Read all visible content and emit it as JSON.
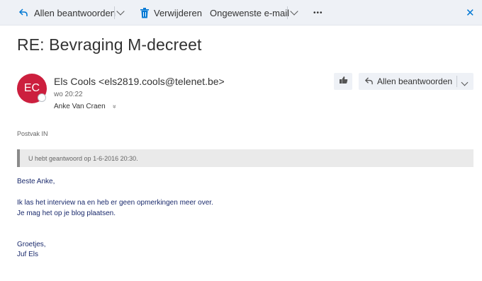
{
  "toolbar": {
    "reply_all_label": "Allen beantwoorden",
    "delete_label": "Verwijderen",
    "junk_label": "Ongewenste e-mail",
    "more_label": "•••",
    "close_label": "✕",
    "accent": "#0078d4"
  },
  "message": {
    "subject": "RE: Bevraging M-decreet",
    "sender_initials": "EC",
    "sender": "Els Cools <els2819.cools@telenet.be>",
    "sent": "wo 20:22",
    "to": "Anke Van Craen",
    "expand_icon": "»",
    "reply_all_label": "Allen beantwoorden",
    "folder": "Postvak IN",
    "notice": "U hebt geantwoord op 1-6-2016 20:30.",
    "avatar_color": "#cc1f3e"
  },
  "body": {
    "greeting": "Beste Anke,",
    "line1": "Ik las het interview na en heb er geen opmerkingen meer over.",
    "line2": "Je mag het op je blog plaatsen.",
    "closing": "Groetjes,",
    "signature": "Juf Els"
  }
}
